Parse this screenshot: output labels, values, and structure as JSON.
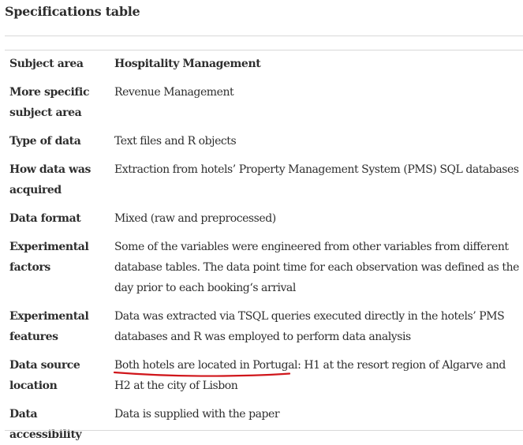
{
  "title": "Specifications table",
  "rows": [
    {
      "label": "Subject area",
      "value": "Hospitality Management"
    },
    {
      "label": "More specific subject area",
      "value": "Revenue Management"
    },
    {
      "label": "Type of data",
      "value": "Text files and R objects"
    },
    {
      "label": "How data was acquired",
      "value": "Extraction from hotels’ Property Management System (PMS) SQL databases"
    },
    {
      "label": "Data format",
      "value": "Mixed (raw and preprocessed)"
    },
    {
      "label": "Experimental factors",
      "value": "Some of the variables were engineered from other variables from different database tables. The data point time for each observation was defined as the day prior to each booking‘s arrival"
    },
    {
      "label": "Experimental features",
      "value": "Data was extracted via TSQL queries executed directly in the hotels’ PMS databases and R was employed to perform data analysis"
    },
    {
      "label": "Data source location",
      "value": "Both hotels are located in Portugal: H1 at the resort region of Algarve and H2 at the city of Lisbon"
    },
    {
      "label": "Data accessibility",
      "value": "Data is supplied with the paper"
    }
  ],
  "annotation_color": "#d0161b"
}
